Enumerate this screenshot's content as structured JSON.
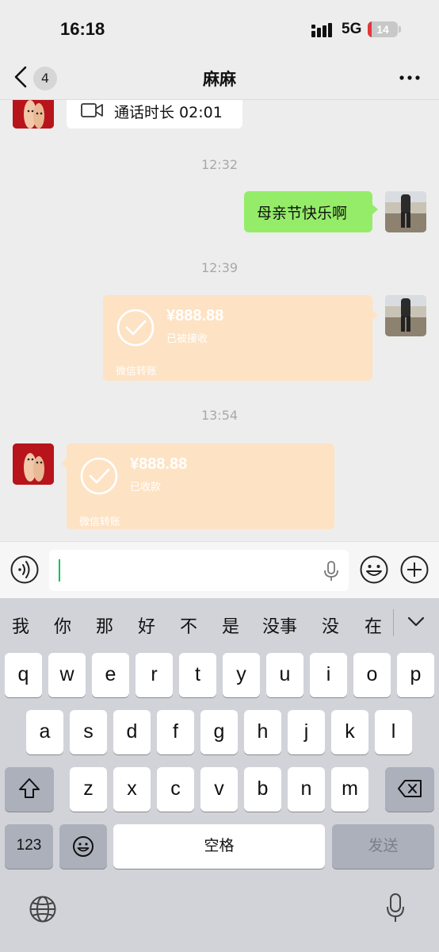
{
  "status_bar": {
    "time": "16:18",
    "network": "5G",
    "battery": "14",
    "battery_level": 0.14
  },
  "nav": {
    "back_count": "4",
    "title": "麻麻",
    "more_icon": "more-dots-icon"
  },
  "messages": {
    "call": {
      "text": "通话时长 02:01",
      "icon": "video-call-icon"
    },
    "ts1": "12:32",
    "greeting": "母亲节快乐啊",
    "ts2": "12:39",
    "transfer_sent": {
      "amount": "¥888.88",
      "status": "已被接收",
      "footer": "微信转账"
    },
    "ts3": "13:54",
    "transfer_received": {
      "amount": "¥888.88",
      "status": "已收款",
      "footer": "微信转账"
    }
  },
  "input": {
    "value": ""
  },
  "candidates": [
    "我",
    "你",
    "那",
    "好",
    "不",
    "是",
    "没事",
    "没",
    "在"
  ],
  "keyboard": {
    "row1": [
      "q",
      "w",
      "e",
      "r",
      "t",
      "y",
      "u",
      "i",
      "o",
      "p"
    ],
    "row2": [
      "a",
      "s",
      "d",
      "f",
      "g",
      "h",
      "j",
      "k",
      "l"
    ],
    "row3": [
      "z",
      "x",
      "c",
      "v",
      "b",
      "n",
      "m"
    ],
    "numbers": "123",
    "space": "空格",
    "send": "发送"
  },
  "colors": {
    "accent_green": "#95ec69",
    "transfer": "#fde2c4",
    "caret": "#07c160",
    "battery_low": "#e0383a"
  }
}
